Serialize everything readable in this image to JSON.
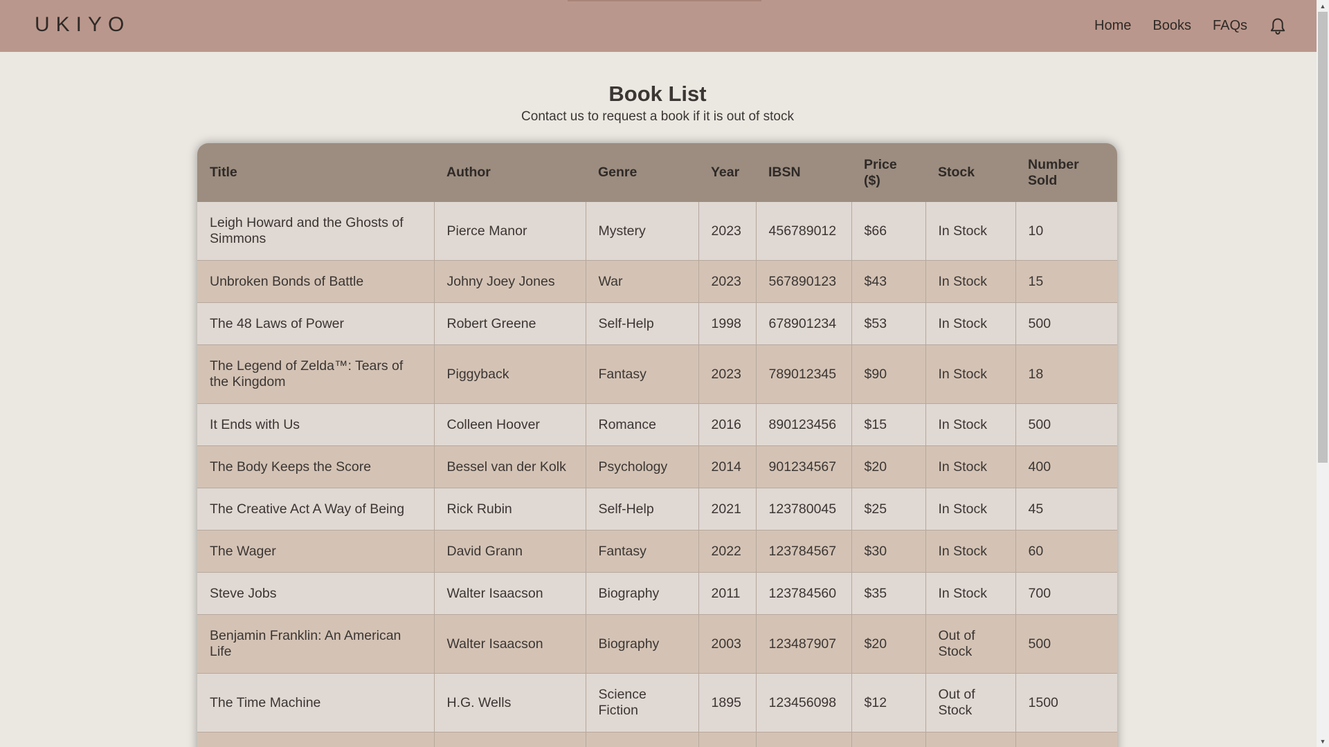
{
  "header": {
    "brand": "UKIYO",
    "nav": [
      "Home",
      "Books",
      "FAQs"
    ],
    "bell_icon": "bell-icon"
  },
  "main": {
    "title": "Book List",
    "subtitle": "Contact us to request a book if it is out of stock"
  },
  "table": {
    "columns": [
      "Title",
      "Author",
      "Genre",
      "Year",
      "IBSN",
      "Price ($)",
      "Stock",
      "Number Sold"
    ],
    "rows": [
      [
        "Leigh Howard and the Ghosts of Simmons",
        "Pierce Manor",
        "Mystery",
        "2023",
        "456789012",
        "$66",
        "In Stock",
        "10"
      ],
      [
        "Unbroken Bonds of Battle",
        "Johny Joey Jones",
        "War",
        "2023",
        "567890123",
        "$43",
        "In Stock",
        "15"
      ],
      [
        "The 48 Laws of Power",
        "Robert Greene",
        "Self-Help",
        "1998",
        "678901234",
        "$53",
        "In Stock",
        "500"
      ],
      [
        "The Legend of Zelda™: Tears of the Kingdom",
        "Piggyback",
        "Fantasy",
        "2023",
        "789012345",
        "$90",
        "In Stock",
        "18"
      ],
      [
        "It Ends with Us",
        "Colleen Hoover",
        "Romance",
        "2016",
        "890123456",
        "$15",
        "In Stock",
        "500"
      ],
      [
        "The Body Keeps the Score",
        "Bessel van der Kolk",
        "Psychology",
        "2014",
        "901234567",
        "$20",
        "In Stock",
        "400"
      ],
      [
        "The Creative Act A Way of Being",
        "Rick Rubin",
        "Self-Help",
        "2021",
        "123780045",
        "$25",
        "In Stock",
        "45"
      ],
      [
        "The Wager",
        "David Grann",
        "Fantasy",
        "2022",
        "123784567",
        "$30",
        "In Stock",
        "60"
      ],
      [
        "Steve Jobs",
        "Walter Isaacson",
        "Biography",
        "2011",
        "123784560",
        "$35",
        "In Stock",
        "700"
      ],
      [
        "Benjamin Franklin: An American Life",
        "Walter Isaacson",
        "Biography",
        "2003",
        "123487907",
        "$20",
        "Out of Stock",
        "500"
      ],
      [
        "The Time Machine",
        "H.G. Wells",
        "Science Fiction",
        "1895",
        "123456098",
        "$12",
        "Out of Stock",
        "1500"
      ],
      [
        "",
        "",
        "",
        "",
        "",
        "",
        "",
        ""
      ]
    ]
  },
  "colors": {
    "header_bg": "#ba978c",
    "page_bg": "#ebe7e1",
    "table_head_bg": "#9c8d80",
    "row_light": "#e0d8d3",
    "row_dark": "#d4c3b5"
  }
}
